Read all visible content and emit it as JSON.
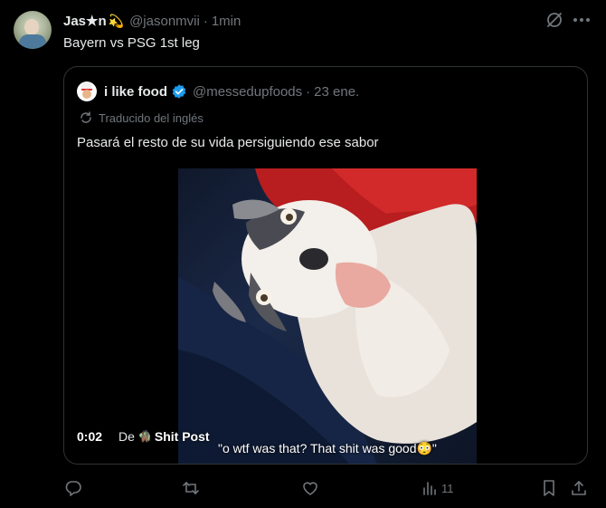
{
  "tweet": {
    "author_name": "Jas★n",
    "author_emoji": "💫",
    "handle": "@jasonmvii",
    "separator": "·",
    "time": "1min",
    "text": "Bayern vs PSG 1st leg"
  },
  "quote": {
    "name": "i like food",
    "handle": "@messedupfoods",
    "separator": "·",
    "time": "23 ene.",
    "translated_label": "Traducido del inglés",
    "text": "Pasará el resto de su vida persiguiendo ese sabor",
    "video": {
      "time": "0:02",
      "source_prefix": "De",
      "source_emoji": "🧌",
      "source_name": "Shit Post",
      "caption": "\"o wtf was that? That shit was good😳\""
    }
  },
  "actions": {
    "views_count": "11"
  },
  "colors": {
    "background": "#000000",
    "text_primary": "#e7e9ea",
    "text_secondary": "#71767b",
    "border": "#2f3336",
    "verified": "#1d9bf0"
  }
}
